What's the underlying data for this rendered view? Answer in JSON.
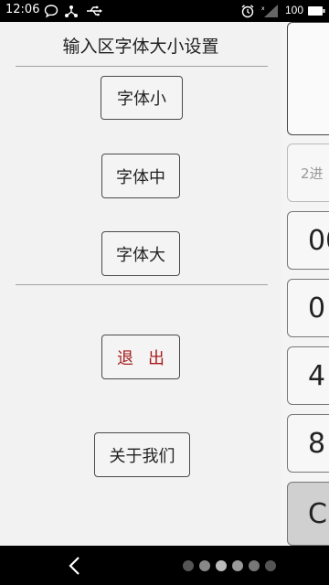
{
  "status_bar": {
    "time": "12:06",
    "battery": "100",
    "icons": [
      "chat-bubble-icon",
      "share-icon",
      "usb-icon",
      "alarm-icon",
      "signal-icon"
    ]
  },
  "background_keypad": {
    "keys": [
      "",
      "2进",
      "00",
      "0",
      "4",
      "8",
      "C"
    ]
  },
  "panel": {
    "title": "输入区字体大小设置",
    "font_small": "字体小",
    "font_medium": "字体中",
    "font_large": "字体大",
    "exit": "退出",
    "about": "关于我们"
  },
  "colors": {
    "exit_text": "#a51c1c",
    "panel_bg": "#f2f2f2"
  }
}
